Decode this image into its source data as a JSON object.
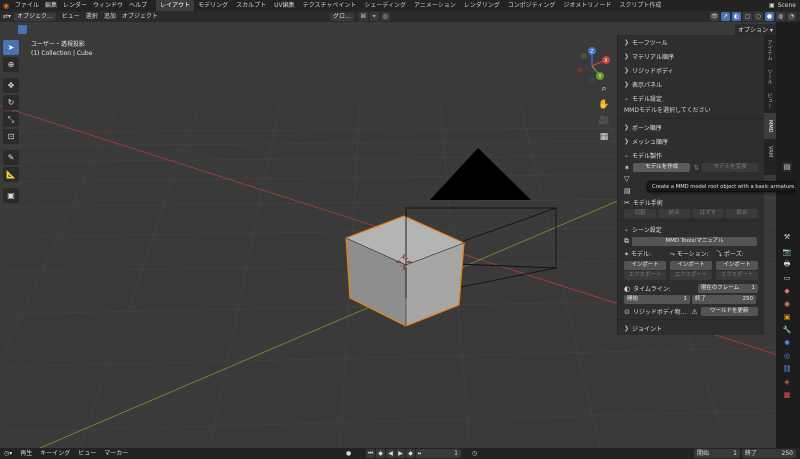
{
  "menu": {
    "items": [
      "ファイル",
      "編集",
      "レンダー",
      "ウィンドウ",
      "ヘルプ"
    ],
    "workspace_tabs": [
      "レイアウト",
      "モデリング",
      "スカルプト",
      "UV編集",
      "テクスチャペイント",
      "シェーディング",
      "アニメーション",
      "レンダリング",
      "コンポジティング",
      "ジオメトリノード",
      "スクリプト作成"
    ],
    "scene": "Scene"
  },
  "viewport_header": {
    "mode": "オブジェク...",
    "menus": [
      "ビュー",
      "選択",
      "追加",
      "オブジェクト"
    ],
    "transform_orientation": "グロ...",
    "options": "オプション"
  },
  "viewport_info": {
    "line1": "ユーザー・透視投影",
    "line2": "(1) Collection | Cube"
  },
  "gizmo": {
    "x": "X",
    "y": "Y",
    "z": "Z"
  },
  "npanel": {
    "morph_tools": "モーフツール",
    "material_order": "マテリアル順序",
    "rigid_body": "リジッドボディ",
    "display_panel": "表示パネル",
    "model_settings": "モデル設定",
    "select_model_note": "MMDモデルを選択してください",
    "bone_order": "ボーン順序",
    "mesh_order": "メッシュ順序",
    "model_production": "モデル製作",
    "create_model": "モデルを作成",
    "convert_model": "モデルを変換",
    "model_handwork": "モデル手術",
    "split": "切割",
    "join": "結合",
    "separate": "はずす",
    "merge": "統合",
    "scene_settings": "シーン設定",
    "manual_button": "MMD Tools/マニュアル",
    "model_label": "モデル:",
    "motion_label": "モーション:",
    "pose_label": "ポーズ:",
    "import": "インポート",
    "export": "エクスポート",
    "timeline_label": "タイムライン:",
    "current_frame_label": "現在のフレーム",
    "current_frame_value": "1",
    "start_label": "開始",
    "start_value": "1",
    "end_label": "終了",
    "end_value": "250",
    "rigid_body_physics": "リジッドボディ物...",
    "update_world": "ワールドを更新",
    "joints": "ジョイント"
  },
  "vtabs": [
    "アイテム",
    "ツール",
    "ビュー",
    "MMD",
    "VRM"
  ],
  "tooltip": "Create a MMD model root object with a basic armature.",
  "timeline": {
    "menus": [
      "再生",
      "キーイング",
      "ビュー",
      "マーカー"
    ],
    "current_frame": "1",
    "start_label": "開始",
    "start": "1",
    "end_label": "終了",
    "end": "250"
  },
  "colors": {
    "accent": "#4772b3",
    "selection_outline": "#e87d0d",
    "x_axis": "#b33a3a",
    "y_axis": "#6b9a2b"
  }
}
